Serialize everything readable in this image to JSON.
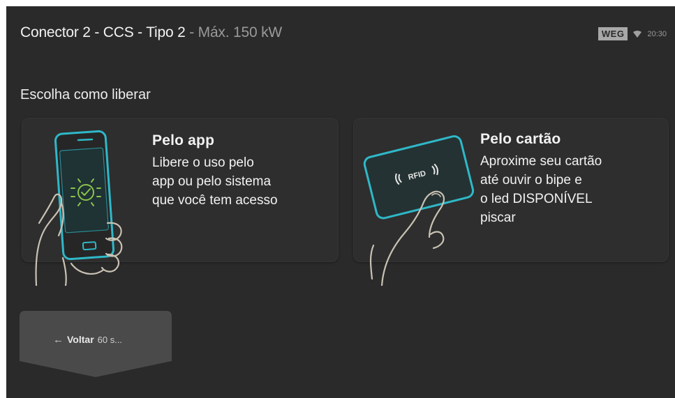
{
  "header": {
    "title": "Conector 2 - CCS - Tipo 2",
    "title_suffix": " - Máx. 150 kW",
    "logo_text": "WEG",
    "status_icon": "wifi-icon",
    "time": "20:30"
  },
  "main": {
    "prompt": "Escolha como liberar",
    "options": [
      {
        "heading": "Pelo app",
        "description": "Libere o uso pelo\napp ou pelo sistema\nque você tem acesso",
        "icon": "phone-hand-icon"
      },
      {
        "heading": "Pelo cartão",
        "description": "Aproxime seu cartão\naté ouvir o bipe e\no led DISPONÍVEL\npiscar",
        "icon": "rfid-card-hand-icon",
        "card_label": "RFID"
      }
    ]
  },
  "footer": {
    "back_label": "Voltar",
    "countdown": "60 s...",
    "back_icon": "arrow-left-icon"
  },
  "colors": {
    "background": "#2a2a2a",
    "accent_cyan": "#2fb8c8",
    "accent_green": "#8bc34a",
    "text": "#f2f2f2",
    "muted": "#9a9a9a"
  }
}
